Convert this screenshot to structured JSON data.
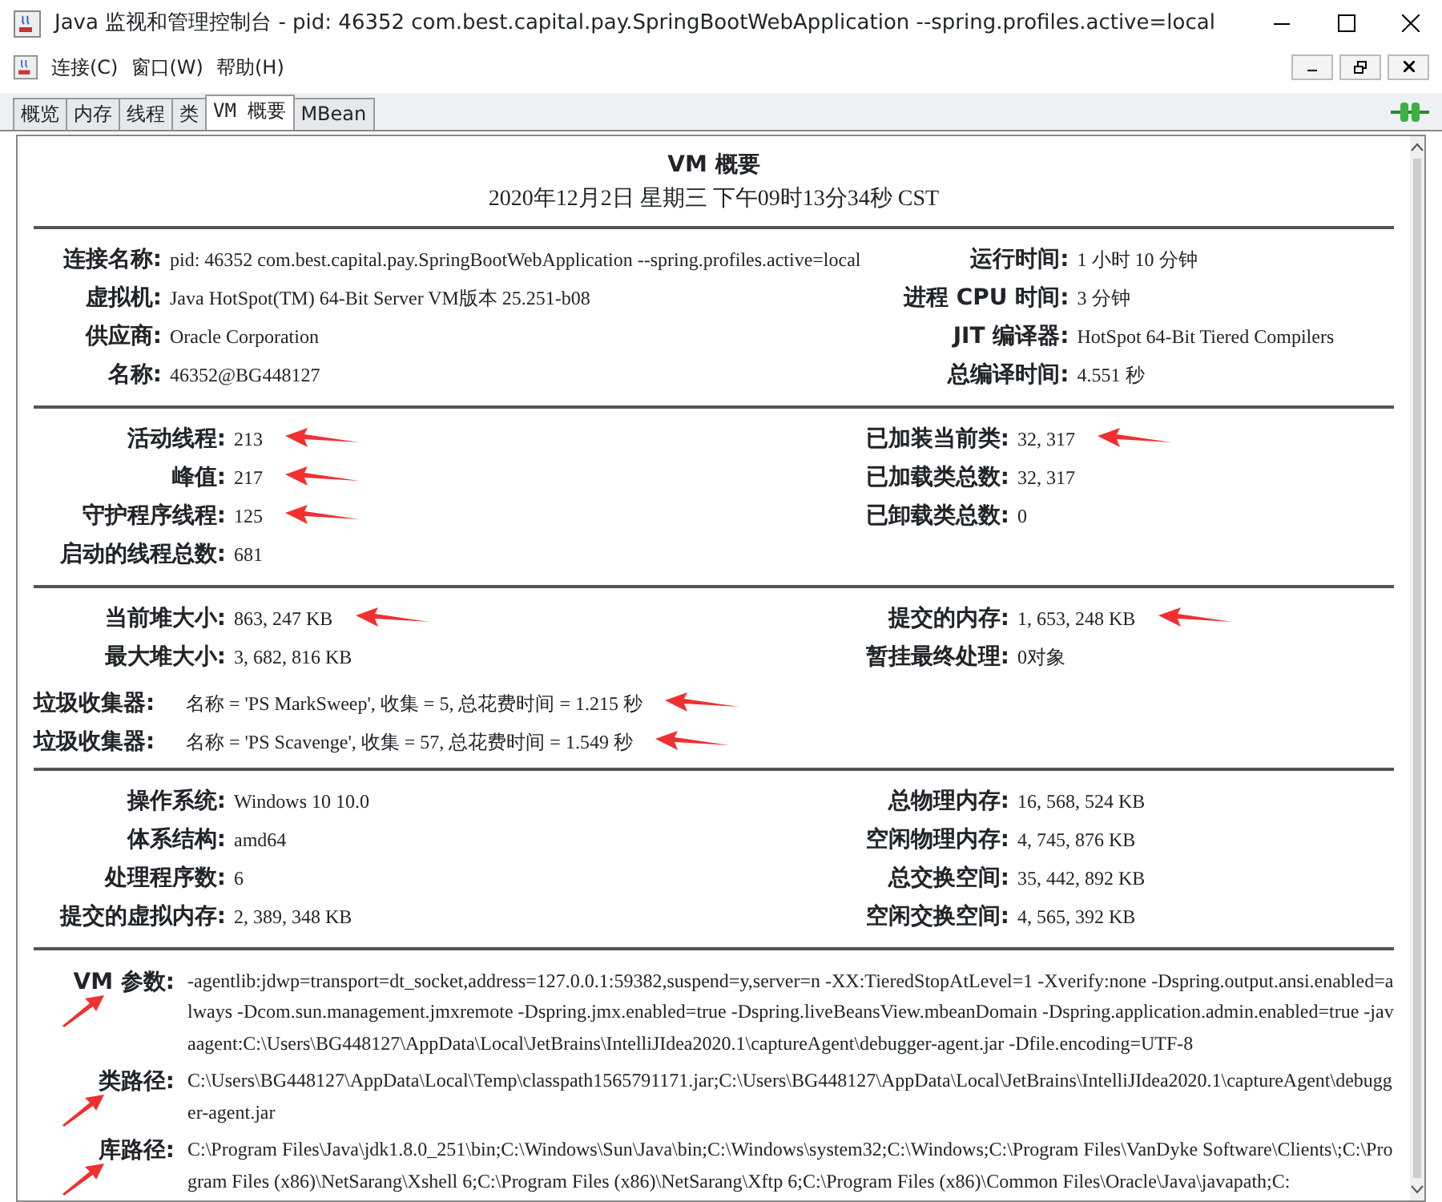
{
  "window": {
    "title": "Java 监视和管理控制台 - pid: 46352 com.best.capital.pay.SpringBootWebApplication --spring.profiles.active=local"
  },
  "menu": [
    "连接(C)",
    "窗口(W)",
    "帮助(H)"
  ],
  "tabs": [
    {
      "label": "概览",
      "selected": false
    },
    {
      "label": "内存",
      "selected": false
    },
    {
      "label": "线程",
      "selected": false
    },
    {
      "label": "类",
      "selected": false
    },
    {
      "label": "VM 概要",
      "selected": true
    },
    {
      "label": "MBean",
      "selected": false
    }
  ],
  "summary": {
    "title": "VM 概要",
    "timestamp": "2020年12月2日 星期三 下午09时13分34秒 CST"
  },
  "sections": [
    {
      "left": [
        {
          "label": "连接名称:",
          "value": "pid: 46352 com.best.capital.pay.SpringBootWebApplication --spring.profiles.active=local",
          "marked": false
        },
        {
          "label": "虚拟机:",
          "value": "Java HotSpot(TM) 64-Bit Server VM版本 25.251-b08",
          "marked": false
        },
        {
          "label": "供应商:",
          "value": "Oracle Corporation",
          "marked": false
        },
        {
          "label": "名称:",
          "value": "46352@BG448127",
          "marked": false
        }
      ],
      "right": [
        {
          "label": "运行时间:",
          "value": "1 小时 10 分钟",
          "marked": false
        },
        {
          "label": "进程 CPU 时间:",
          "value": "3 分钟",
          "marked": false
        },
        {
          "label": "JIT 编译器:",
          "value": "HotSpot 64-Bit Tiered Compilers",
          "marked": false
        },
        {
          "label": "总编译时间:",
          "value": "4.551 秒",
          "marked": false
        }
      ]
    },
    {
      "left": [
        {
          "label": "活动线程:",
          "value": "213",
          "marked": true
        },
        {
          "label": "峰值:",
          "value": "217",
          "marked": true
        },
        {
          "label": "守护程序线程:",
          "value": "125",
          "marked": true
        },
        {
          "label": "启动的线程总数:",
          "value": "681",
          "marked": false
        }
      ],
      "right": [
        {
          "label": "已加装当前类:",
          "value": "32, 317",
          "marked": true
        },
        {
          "label": "已加载类总数:",
          "value": "32, 317",
          "marked": false
        },
        {
          "label": "已卸载类总数:",
          "value": "0",
          "marked": false
        }
      ]
    },
    {
      "left": [
        {
          "label": "当前堆大小:",
          "value": "863, 247 KB",
          "marked": true
        },
        {
          "label": "最大堆大小:",
          "value": "3, 682, 816 KB",
          "marked": false
        }
      ],
      "right": [
        {
          "label": "提交的内存:",
          "value": "1, 653, 248 KB",
          "marked": true
        },
        {
          "label": "暂挂最终处理:",
          "value": "0对象",
          "marked": false
        }
      ],
      "collectors": [
        {
          "label": "垃圾收集器:",
          "value": "名称 = 'PS MarkSweep', 收集 = 5, 总花费时间 = 1.215 秒",
          "marked": true
        },
        {
          "label": "垃圾收集器:",
          "value": "名称 = 'PS Scavenge', 收集 = 57, 总花费时间 = 1.549 秒",
          "marked": true
        }
      ]
    },
    {
      "left": [
        {
          "label": "操作系统:",
          "value": "Windows 10 10.0",
          "marked": false
        },
        {
          "label": "体系结构:",
          "value": "amd64",
          "marked": false
        },
        {
          "label": "处理程序数:",
          "value": "6",
          "marked": false
        },
        {
          "label": "提交的虚拟内存:",
          "value": "2, 389, 348 KB",
          "marked": false
        }
      ],
      "right": [
        {
          "label": "总物理内存:",
          "value": "16, 568, 524 KB",
          "marked": false
        },
        {
          "label": "空闲物理内存:",
          "value": "4, 745, 876 KB",
          "marked": false
        },
        {
          "label": "总交换空间:",
          "value": "35, 442, 892 KB",
          "marked": false
        },
        {
          "label": "空闲交换空间:",
          "value": "4, 565, 392 KB",
          "marked": false
        }
      ]
    }
  ],
  "vm_info": [
    {
      "label": "VM 参数:",
      "value": "-agentlib:jdwp=transport=dt_socket,address=127.0.0.1:59382,suspend=y,server=n -XX:TieredStopAtLevel=1 -Xverify:none -Dspring.output.ansi.enabled=always -Dcom.sun.management.jmxremote -Dspring.jmx.enabled=true -Dspring.liveBeansView.mbeanDomain -Dspring.application.admin.enabled=true -javaagent:C:\\Users\\BG448127\\AppData\\Local\\JetBrains\\IntelliJIdea2020.1\\captureAgent\\debugger-agent.jar -Dfile.encoding=UTF-8",
      "marked": true
    },
    {
      "label": "类路径:",
      "value": "C:\\Users\\BG448127\\AppData\\Local\\Temp\\classpath1565791171.jar;C:\\Users\\BG448127\\AppData\\Local\\JetBrains\\IntelliJIdea2020.1\\captureAgent\\debugger-agent.jar",
      "marked": true
    },
    {
      "label": "库路径:",
      "value": "C:\\Program Files\\Java\\jdk1.8.0_251\\bin;C:\\Windows\\Sun\\Java\\bin;C:\\Windows\\system32;C:\\Windows;C:\\Program Files\\VanDyke Software\\Clients\\;C:\\Program Files (x86)\\NetSarang\\Xshell 6;C:\\Program Files (x86)\\NetSarang\\Xftp 6;C:\\Program Files (x86)\\Common Files\\Oracle\\Java\\javapath;C:",
      "marked": true
    }
  ]
}
